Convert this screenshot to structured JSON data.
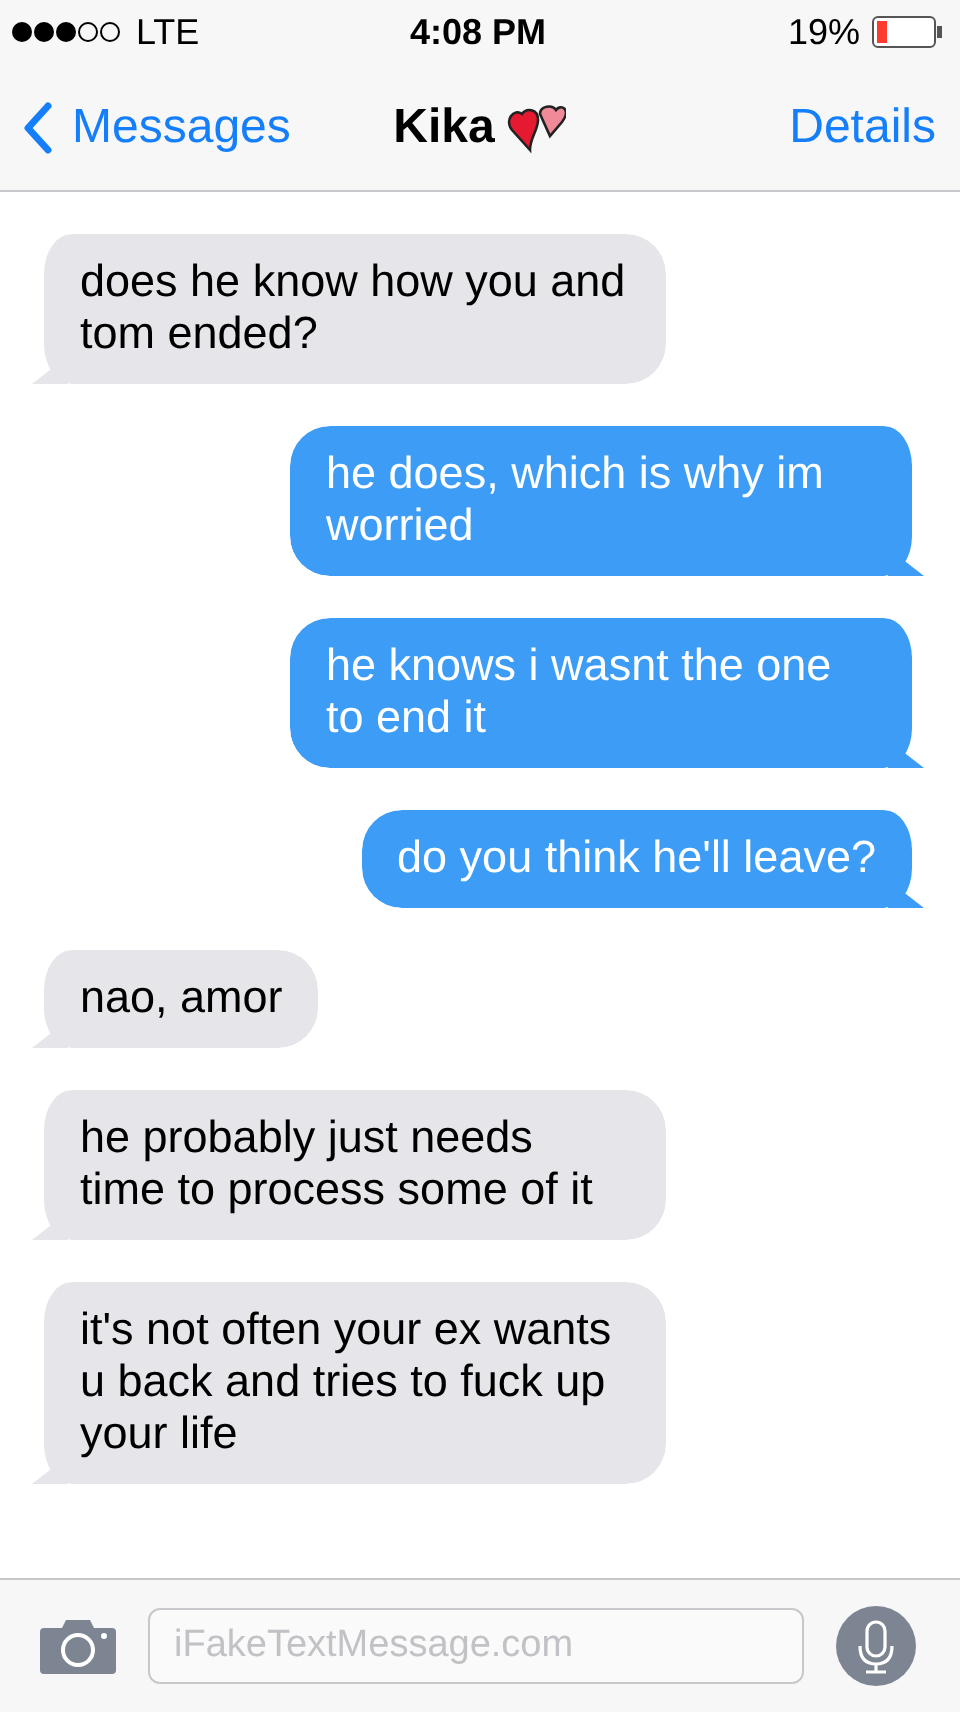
{
  "status_bar": {
    "carrier": "LTE",
    "time": "4:08 PM",
    "battery": "19%"
  },
  "nav": {
    "back": "Messages",
    "title": "Kika",
    "action": "Details"
  },
  "messages": [
    {
      "kind": "received",
      "text": "does he know how you and tom ended?"
    },
    {
      "kind": "sent",
      "text": "he does, which is why im worried"
    },
    {
      "kind": "sent",
      "text": "he knows i wasnt the one to end it"
    },
    {
      "kind": "sent",
      "text": "do you think he'll leave?"
    },
    {
      "kind": "received",
      "text": "nao, amor"
    },
    {
      "kind": "received",
      "text": "he probably just needs time to process some of it"
    },
    {
      "kind": "received",
      "text": "it's not often your ex wants u back and tries to fuck up your life"
    }
  ],
  "composer": {
    "placeholder": "iFakeTextMessage.com"
  }
}
